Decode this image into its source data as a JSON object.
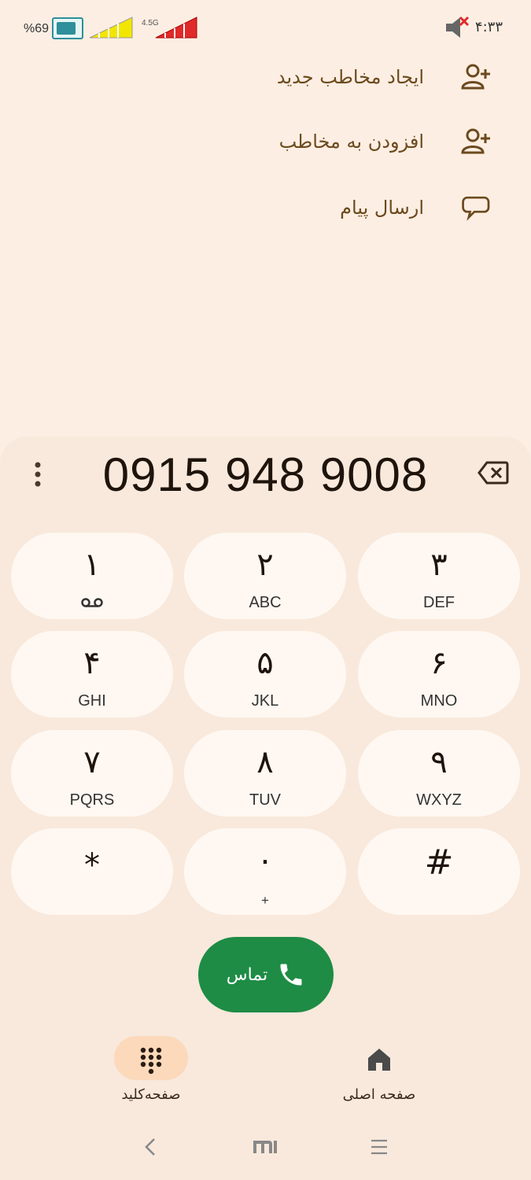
{
  "status_bar": {
    "battery_text": "%69",
    "network_type": "4.5G",
    "time": "۴:۳۳"
  },
  "actions": [
    {
      "label": "ایجاد مخاطب جدید",
      "icon": "person-add-icon"
    },
    {
      "label": "افزودن به مخاطب",
      "icon": "person-add-icon"
    },
    {
      "label": "ارسال پیام",
      "icon": "message-bubble-icon"
    }
  ],
  "dialer": {
    "number": "0915 948 9008",
    "keys": [
      {
        "digit": "۱",
        "letters": ""
      },
      {
        "digit": "۲",
        "letters": "ABC"
      },
      {
        "digit": "۳",
        "letters": "DEF"
      },
      {
        "digit": "۴",
        "letters": "GHI"
      },
      {
        "digit": "۵",
        "letters": "JKL"
      },
      {
        "digit": "۶",
        "letters": "MNO"
      },
      {
        "digit": "۷",
        "letters": "PQRS"
      },
      {
        "digit": "۸",
        "letters": "TUV"
      },
      {
        "digit": "۹",
        "letters": "WXYZ"
      },
      {
        "digit": "*",
        "letters": ""
      },
      {
        "digit": "۰",
        "letters": "+"
      },
      {
        "digit": "#",
        "letters": ""
      }
    ],
    "call_label": "تماس"
  },
  "bottom_nav": {
    "home_label": "صفحه اصلی",
    "keypad_label": "صفحه‌کلید"
  },
  "colors": {
    "background": "#fdeee3",
    "panel": "#f8e9dc",
    "key": "#fff8f2",
    "accent_brown": "#6b4a1e",
    "call_green": "#1e8c45",
    "nav_pill": "#fcd9bb"
  }
}
